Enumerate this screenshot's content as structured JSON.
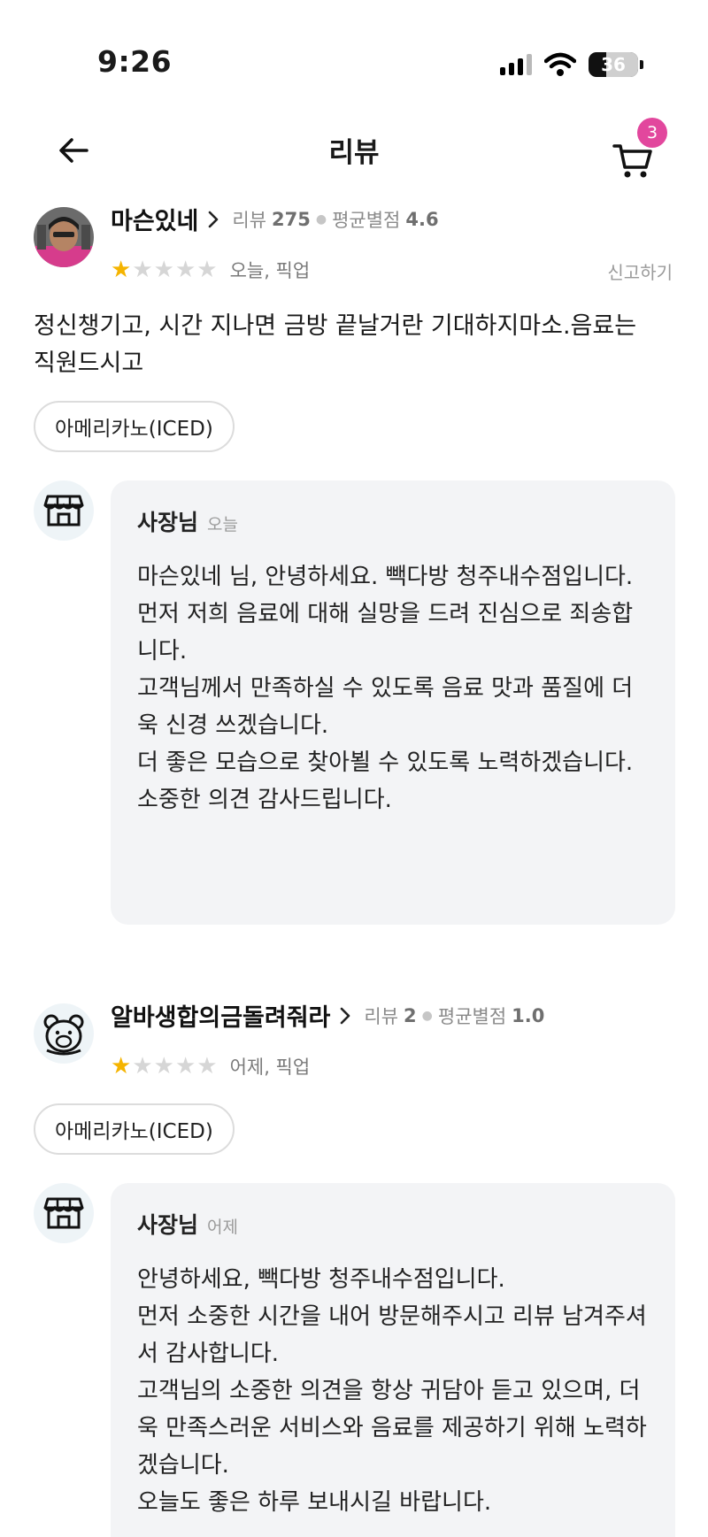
{
  "status_bar": {
    "time": "9:26",
    "battery": "36"
  },
  "header": {
    "title": "리뷰",
    "cart_count": "3"
  },
  "reviews": [
    {
      "user": "마슨있네",
      "review_label": "리뷰",
      "review_count": "275",
      "avg_label": "평균별점",
      "avg_rating": "4.6",
      "rating": 1,
      "when": "오늘, 픽업",
      "report": "신고하기",
      "text": "정신챙기고, 시간 지나면 금방 끝날거란 기대하지마소.음료는 직원드시고",
      "menu": "아메리카노(ICED)",
      "reply": {
        "name": "사장님",
        "when": "오늘",
        "body": "마슨있네 님, 안녕하세요. 빽다방 청주내수점입니다.\n먼저 저희 음료에 대해 실망을 드려 진심으로 죄송합니다.\n고객님께서 만족하실 수 있도록 음료 맛과 품질에 더욱 신경 쓰겠습니다.\n더 좋은 모습으로 찾아뵐 수 있도록 노력하겠습니다.\n소중한 의견 감사드립니다."
      }
    },
    {
      "user": "알바생합의금돌려줘라",
      "review_label": "리뷰",
      "review_count": "2",
      "avg_label": "평균별점",
      "avg_rating": "1.0",
      "rating": 1,
      "when": "어제, 픽업",
      "menu": "아메리카노(ICED)",
      "reply": {
        "name": "사장님",
        "when": "어제",
        "body": "안녕하세요, 빽다방 청주내수점입니다.\n먼저 소중한 시간을 내어 방문해주시고 리뷰 남겨주셔서 감사합니다.\n고객님의 소중한 의견을 항상 귀담아 듣고 있으며, 더욱 만족스러운 서비스와 음료를 제공하기 위해 노력하겠습니다.\n오늘도 좋은 하루 보내시길 바랍니다."
      }
    }
  ],
  "colors": {
    "badge": "#e2479d",
    "star_on": "#f5b400",
    "star_off": "#d6d6d6",
    "reply_bg": "#f3f4f6"
  },
  "icons": {
    "back": "arrow-left-icon",
    "cart": "cart-icon",
    "store": "store-icon",
    "bear": "bear-icon",
    "chevron": "chevron-right-icon"
  }
}
